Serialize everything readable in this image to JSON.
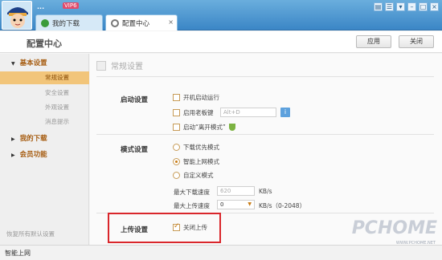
{
  "app": {
    "username": "...",
    "vip_badge": "VIP6"
  },
  "tabs": [
    {
      "label": "我的下载"
    },
    {
      "label": "配置中心"
    }
  ],
  "header": {
    "title": "配置中心",
    "apply_label": "应用",
    "close_label": "关闭"
  },
  "sidebar": {
    "groups": [
      {
        "label": "基本设置",
        "items": [
          "常规设置",
          "安全设置",
          "外观设置",
          "消息提示"
        ]
      },
      {
        "label": "我的下载"
      },
      {
        "label": "会员功能"
      }
    ],
    "restore_label": "恢复所有默认设置"
  },
  "main": {
    "section_title": "常规设置",
    "startup": {
      "label": "启动设置",
      "autostart": "开机启动运行",
      "boss_key": "启用老板键",
      "boss_key_value": "Alt+D",
      "leave_mode": "启动“离开模式”"
    },
    "mode": {
      "label": "模式设置",
      "options": [
        "下载优先模式",
        "智能上网模式",
        "自定义模式"
      ],
      "max_download_label": "最大下载速度",
      "max_download_value": "620",
      "max_upload_label": "最大上传速度",
      "max_upload_value": "0",
      "unit": "KB/s",
      "upload_range": "KB/s（0-2048）"
    },
    "upload": {
      "label": "上传设置",
      "option": "关闭上传"
    }
  },
  "status": {
    "text": "智能上网"
  },
  "watermark": {
    "main": "PCHOME",
    "sub": "WWW.PCHOME.NET"
  }
}
